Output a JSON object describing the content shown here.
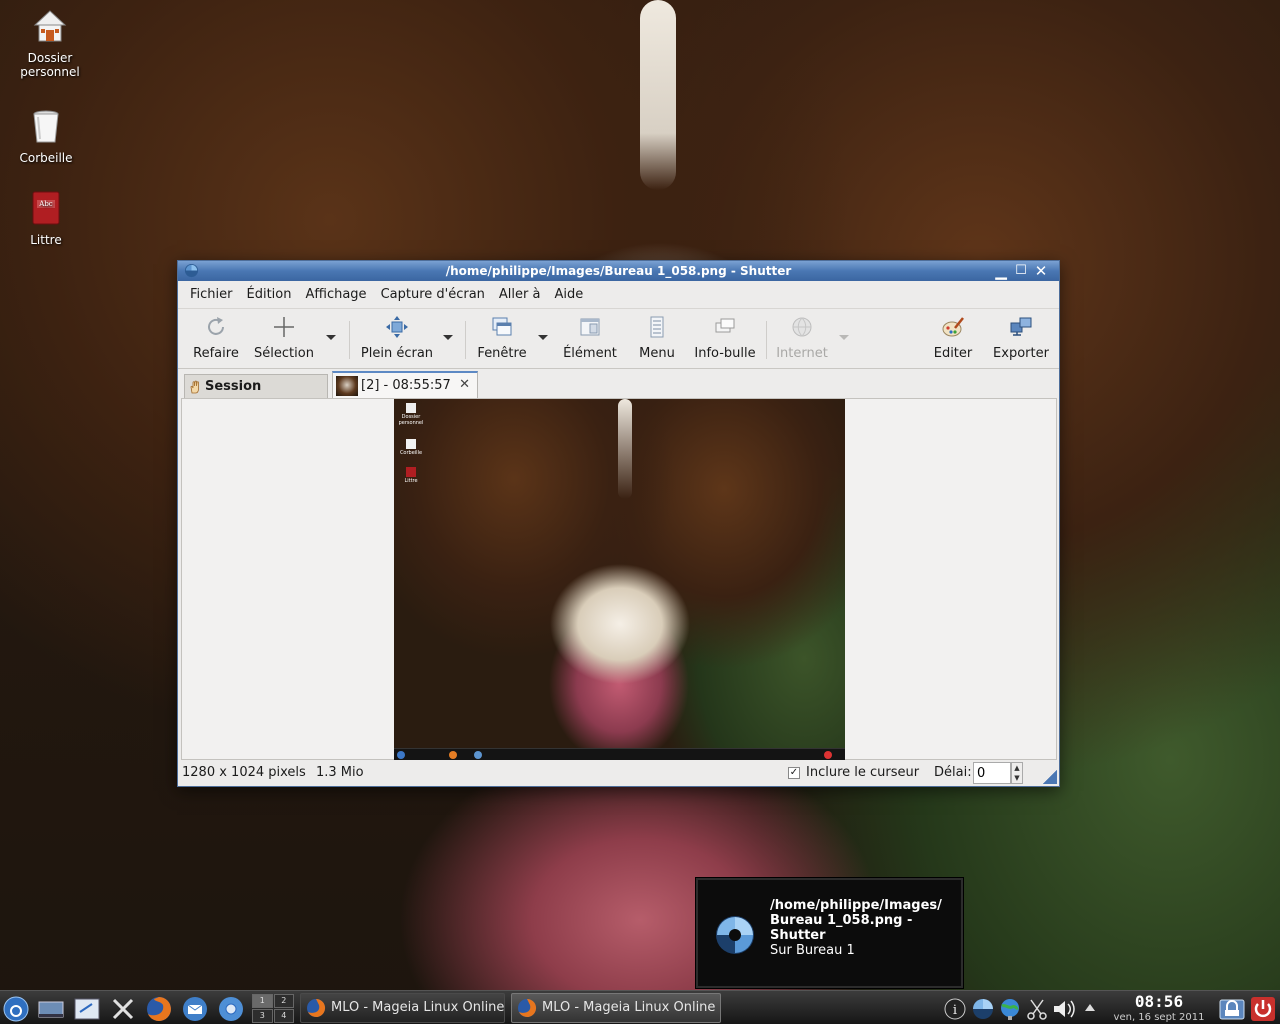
{
  "desktop": {
    "icons": [
      {
        "label_line1": "Dossier",
        "label_line2": "personnel"
      },
      {
        "label_line1": "Corbeille",
        "label_line2": ""
      },
      {
        "label_line1": "Littre",
        "label_line2": ""
      }
    ]
  },
  "window": {
    "title": "/home/philippe/Images/Bureau 1_058.png - Shutter",
    "menu": [
      "Fichier",
      "Édition",
      "Affichage",
      "Capture d'écran",
      "Aller à",
      "Aide"
    ],
    "toolbar": {
      "redo": "Refaire",
      "selection": "Sélection",
      "fullscreen": "Plein écran",
      "window": "Fenêtre",
      "element": "Élément",
      "menu": "Menu",
      "tooltip": "Info-bulle",
      "internet": "Internet",
      "edit": "Editer",
      "export": "Exporter"
    },
    "tabs": {
      "session": "Session",
      "screenshot": "[2] - 08:55:57"
    },
    "status": {
      "dimensions": "1280 x 1024 pixels",
      "size": "1.3 Mio",
      "include_cursor_label": "Inclure le curseur",
      "include_cursor_checked": "✓",
      "delay_label": "Délai:",
      "delay_value": "0"
    }
  },
  "preview_icons": [
    "Dossier personnel",
    "Corbeille",
    "Littre"
  ],
  "notification": {
    "title": "/home/philippe/Images/ Bureau 1_058.png - Shutter",
    "body": "Sur Bureau 1"
  },
  "taskbar": {
    "pager": [
      "1",
      "2",
      "3",
      "4"
    ],
    "task1": "MLO - Mageia Linux Online :",
    "task2": "MLO - Mageia Linux Online : Bure",
    "time": "08:56",
    "date": "ven, 16 sept 2011"
  },
  "colors": {
    "titlebar": "#4a77b3",
    "accent": "#5d89c4"
  }
}
